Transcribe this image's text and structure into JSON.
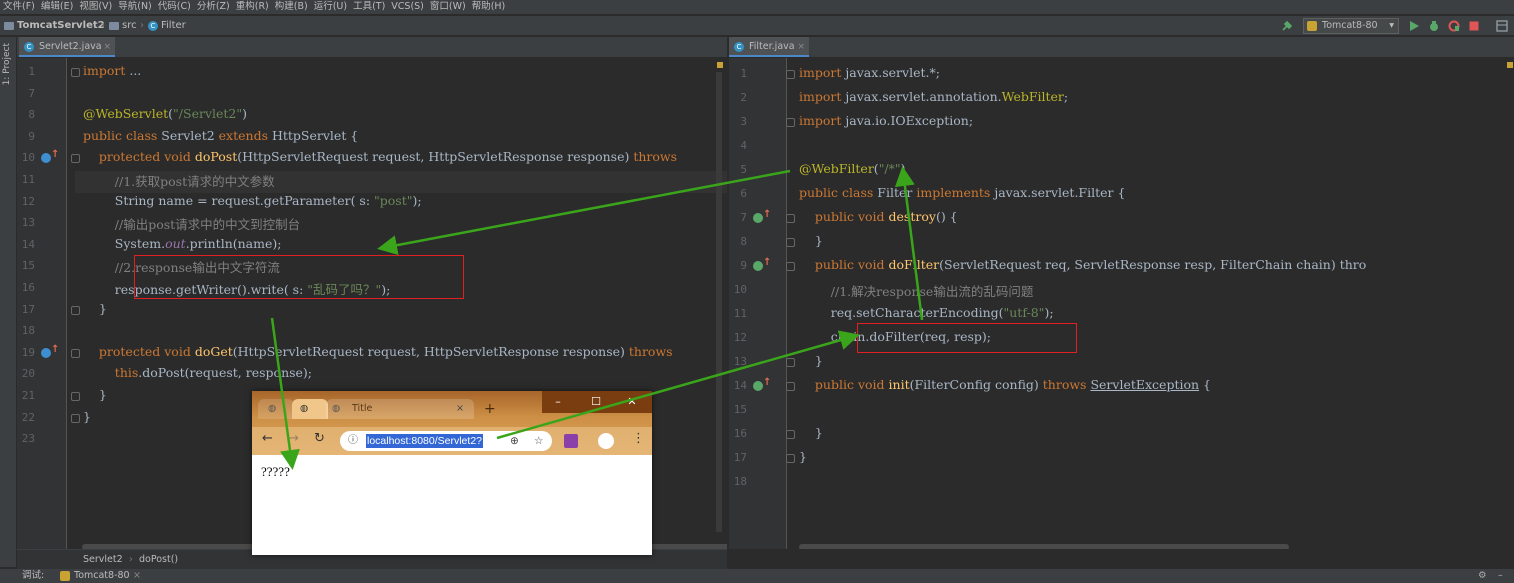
{
  "menu": [
    "文件(F)",
    "编辑(E)",
    "视图(V)",
    "导航(N)",
    "代码(C)",
    "分析(Z)",
    "重构(R)",
    "构建(B)",
    "运行(U)",
    "工具(T)",
    "VCS(S)",
    "窗口(W)",
    "帮助(H)"
  ],
  "nav": {
    "project": "TomcatServlet2",
    "folder": "src",
    "file": "Filter",
    "run_config": "Tomcat8-80"
  },
  "left_tool": {
    "project_label": "1: Project"
  },
  "left_editor": {
    "tab": "Servlet2.java",
    "lines": [
      {
        "n": "1",
        "code": "import ...",
        "fold": true
      },
      {
        "n": "7",
        "code": ""
      },
      {
        "n": "8",
        "code": "@WebServlet(\"/Servlet2\")"
      },
      {
        "n": "9",
        "code": "public class Servlet2 extends HttpServlet {"
      },
      {
        "n": "10",
        "code": "    protected void doPost(HttpServletRequest request, HttpServletResponse response) throws"
      },
      {
        "n": "11",
        "code": "        //1.获取post请求的中文参数"
      },
      {
        "n": "12",
        "code": "        String name = request.getParameter( s: \"post\");"
      },
      {
        "n": "13",
        "code": "        //输出post请求中的中文到控制台"
      },
      {
        "n": "14",
        "code": "        System.out.println(name);"
      },
      {
        "n": "15",
        "code": "        //2.response输出中文字符流"
      },
      {
        "n": "16",
        "code": "        response.getWriter().write( s: \"乱码了吗？\");"
      },
      {
        "n": "17",
        "code": "    }"
      },
      {
        "n": "18",
        "code": ""
      },
      {
        "n": "19",
        "code": "    protected void doGet(HttpServletRequest request, HttpServletResponse response) throws"
      },
      {
        "n": "20",
        "code": "        this.doPost(request, response);"
      },
      {
        "n": "21",
        "code": "    }"
      },
      {
        "n": "22",
        "code": "}"
      },
      {
        "n": "23",
        "code": ""
      }
    ],
    "breadcrumb": [
      "Servlet2",
      "doPost()"
    ]
  },
  "right_editor": {
    "tab": "Filter.java",
    "lines": [
      {
        "n": "1",
        "code": "import javax.servlet.*;"
      },
      {
        "n": "2",
        "code": "import javax.servlet.annotation.WebFilter;"
      },
      {
        "n": "3",
        "code": "import java.io.IOException;"
      },
      {
        "n": "4",
        "code": ""
      },
      {
        "n": "5",
        "code": "@WebFilter(\"/*\")"
      },
      {
        "n": "6",
        "code": "public class Filter implements javax.servlet.Filter {"
      },
      {
        "n": "7",
        "code": "    public void destroy() {"
      },
      {
        "n": "8",
        "code": "    }"
      },
      {
        "n": "9",
        "code": "    public void doFilter(ServletRequest req, ServletResponse resp, FilterChain chain) thro"
      },
      {
        "n": "10",
        "code": "        //1.解决response输出流的乱码问题"
      },
      {
        "n": "11",
        "code": "        req.setCharacterEncoding(\"utf-8\");"
      },
      {
        "n": "12",
        "code": "        chain.doFilter(req, resp);"
      },
      {
        "n": "13",
        "code": "    }"
      },
      {
        "n": "14",
        "code": "    public void init(FilterConfig config) throws ServletException {"
      },
      {
        "n": "15",
        "code": ""
      },
      {
        "n": "16",
        "code": "    }"
      },
      {
        "n": "17",
        "code": "}"
      },
      {
        "n": "18",
        "code": ""
      }
    ]
  },
  "browser": {
    "tab_title": "Title",
    "url": "localhost:8080/Servlet2?",
    "page_text": "?????"
  },
  "status": {
    "debug_label": "调试:",
    "debug_config": "Tomcat8-80"
  },
  "colors": {
    "editor_bg": "#2b2b2b",
    "keyword": "#cc7832",
    "string": "#6a8759",
    "annotation": "#bbb529",
    "comment": "#808080",
    "highlight_box": "#e02020",
    "arrow": "#3aa51a"
  }
}
